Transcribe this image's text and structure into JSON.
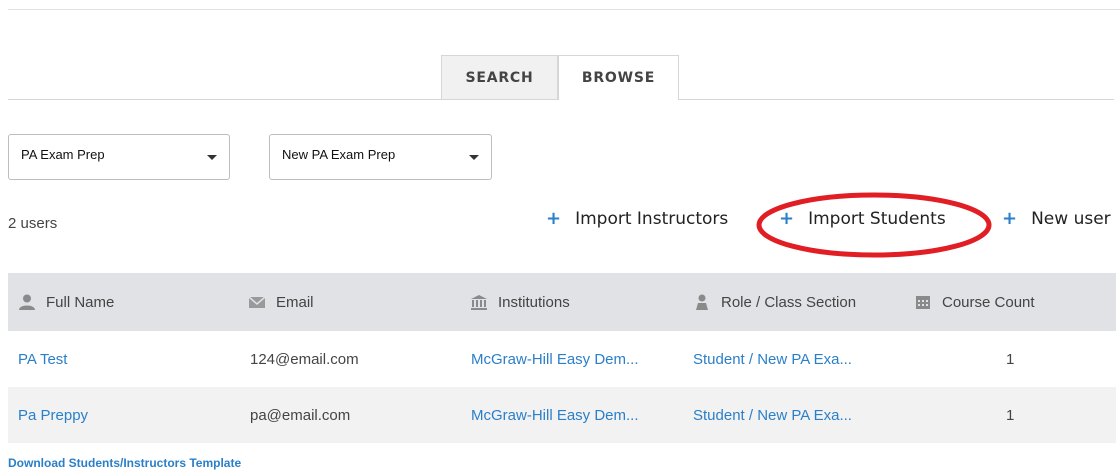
{
  "tabs": [
    {
      "label": "SEARCH",
      "active": false
    },
    {
      "label": "BROWSE",
      "active": true
    }
  ],
  "filters": {
    "program_selected": "PA Exam Prep",
    "section_selected": "New PA Exam Prep"
  },
  "users_count": "2 users",
  "actions": {
    "import_instructors": "Import Instructors",
    "import_students": "Import Students",
    "new_user": "New user",
    "plus": "+"
  },
  "table": {
    "columns": [
      {
        "label": "Full Name",
        "icon": "person-icon"
      },
      {
        "label": "Email",
        "icon": "envelope-icon"
      },
      {
        "label": "Institutions",
        "icon": "institution-icon"
      },
      {
        "label": "Role / Class Section",
        "icon": "role-icon"
      },
      {
        "label": "Course Count",
        "icon": "calendar-icon"
      }
    ],
    "rows": [
      {
        "full_name": "PA Test",
        "email": "124@email.com",
        "institution": "McGraw-Hill Easy Dem...",
        "role": "Student / New PA Exa...",
        "course_count": "1"
      },
      {
        "full_name": "Pa Preppy",
        "email": "pa@email.com",
        "institution": "McGraw-Hill Easy Dem...",
        "role": "Student / New PA Exa...",
        "course_count": "1"
      }
    ]
  },
  "download_link": "Download Students/Instructors Template",
  "colors": {
    "link_blue": "#2a7fc9",
    "header_gray": "#e0e2e5",
    "highlight_red": "#e01e24"
  }
}
